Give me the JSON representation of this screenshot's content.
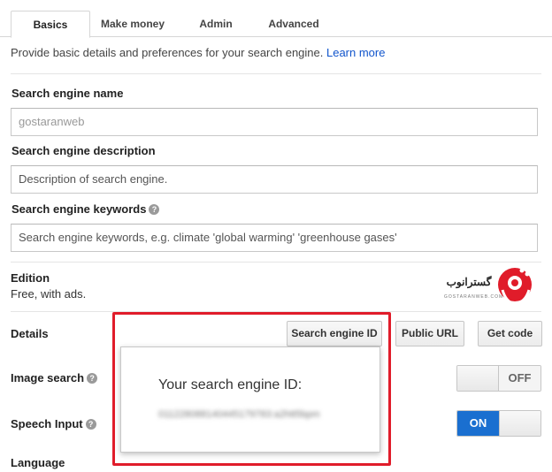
{
  "tabs": [
    {
      "label": "Basics",
      "active": true
    },
    {
      "label": "Make money"
    },
    {
      "label": "Admin"
    },
    {
      "label": "Advanced"
    }
  ],
  "intro": {
    "text": "Provide basic details and preferences for your search engine. ",
    "link": "Learn more"
  },
  "fields": {
    "name": {
      "label": "Search engine name",
      "value": "gostaranweb"
    },
    "description": {
      "label": "Search engine description",
      "placeholder": "Description of search engine."
    },
    "keywords": {
      "label": "Search engine keywords",
      "placeholder": "Search engine keywords, e.g. climate 'global warming' 'greenhouse gases'"
    }
  },
  "edition": {
    "label": "Edition",
    "value": "Free, with ads."
  },
  "logo": {
    "text": "گسترانوب",
    "subtext": "GOSTARANWEB.COM"
  },
  "details": {
    "label": "Details",
    "buttons": {
      "search_engine_id": "Search engine ID",
      "public_url": "Public URL",
      "get_code": "Get code"
    }
  },
  "image_search": {
    "label": "Image search",
    "state": "OFF"
  },
  "speech_input": {
    "label": "Speech Input",
    "state": "ON"
  },
  "language": {
    "label": "Language"
  },
  "popup": {
    "title": "Your search engine ID:",
    "value": "011228088140445179783:a2htt5bpm"
  },
  "colors": {
    "accent": "#1a6fd0",
    "link": "#1155cc",
    "highlight": "#e01c2a"
  }
}
